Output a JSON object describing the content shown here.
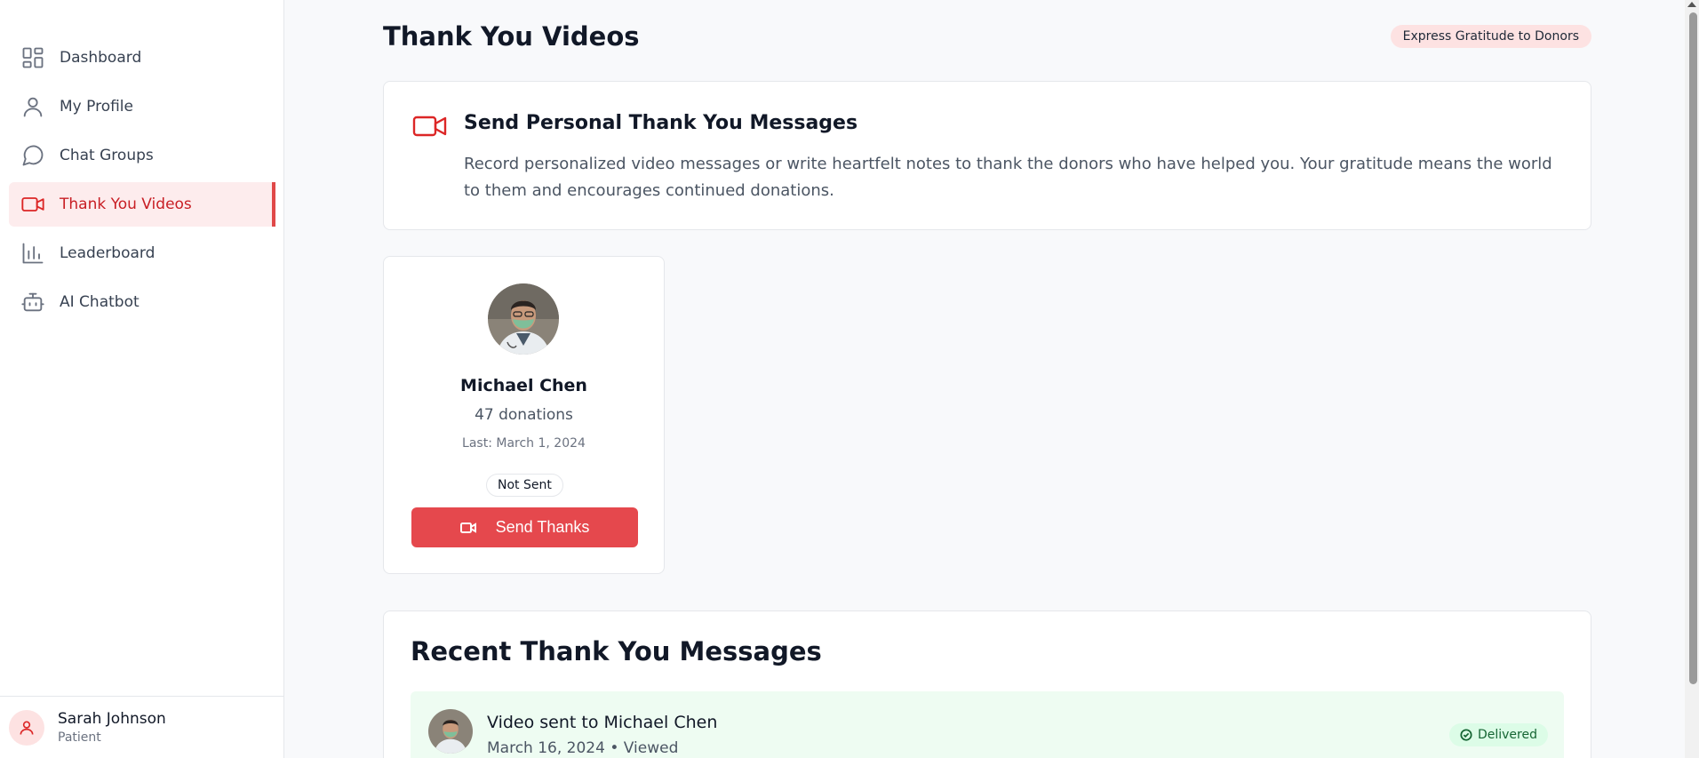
{
  "sidebar": {
    "items": [
      {
        "label": "Dashboard",
        "icon": "dashboard-grid-icon"
      },
      {
        "label": "My Profile",
        "icon": "user-icon"
      },
      {
        "label": "Chat Groups",
        "icon": "chat-bubble-icon"
      },
      {
        "label": "Thank You Videos",
        "icon": "video-camera-icon",
        "active": true
      },
      {
        "label": "Leaderboard",
        "icon": "bar-chart-icon"
      },
      {
        "label": "AI Chatbot",
        "icon": "robot-icon"
      }
    ],
    "user": {
      "name": "Sarah Johnson",
      "role": "Patient",
      "icon": "user-icon"
    }
  },
  "header": {
    "title": "Thank You Videos",
    "badge": "Express Gratitude to Donors"
  },
  "intro": {
    "icon": "video-camera-icon",
    "title": "Send Personal Thank You Messages",
    "description": "Record personalized video messages or write heartfelt notes to thank the donors who have helped you. Your gratitude means the world to them and encourages continued donations."
  },
  "donors": [
    {
      "name": "Michael Chen",
      "donations": "47 donations",
      "last": "Last: March 1, 2024",
      "status": "Not Sent",
      "button_label": "Send Thanks"
    }
  ],
  "recent": {
    "title": "Recent Thank You Messages",
    "messages": [
      {
        "title": "Video sent to Michael Chen",
        "meta": "March 16, 2024 • Viewed",
        "status": "Delivered"
      }
    ]
  },
  "colors": {
    "accent": "#e5484d",
    "active_bg": "#fdeced",
    "success_bg": "#eefcf2"
  }
}
